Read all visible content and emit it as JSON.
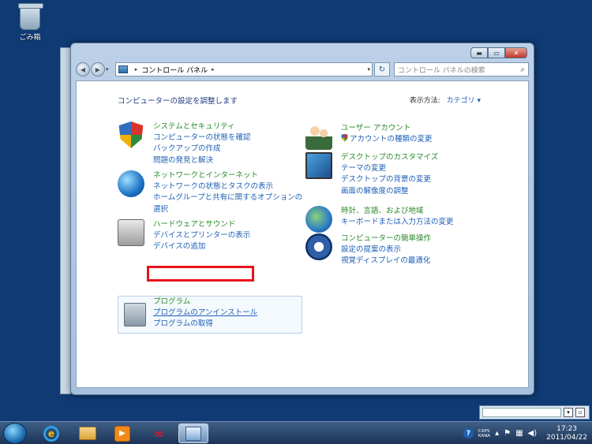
{
  "desktop": {
    "recycle_bin_label": "ごみ箱"
  },
  "window": {
    "address": {
      "path_item": "コントロール パネル",
      "separator": "▸"
    },
    "search": {
      "placeholder": "コントロール パネルの検索"
    },
    "controls": {
      "minimize": "▬",
      "maximize": "▭",
      "close": "✕"
    },
    "page_title": "コンピューターの設定を調整します",
    "view_by": {
      "label": "表示方法:",
      "value": "カテゴリ ▾"
    },
    "left_categories": [
      {
        "icon": "security-shield-icon",
        "heading": "システムとセキュリティ",
        "links": [
          "コンピューターの状態を確認",
          "バックアップの作成",
          "問題の発見と解決"
        ]
      },
      {
        "icon": "network-globe-icon",
        "heading": "ネットワークとインターネット",
        "links": [
          "ネットワークの状態とタスクの表示",
          "ホームグループと共有に関するオプションの",
          "選択"
        ]
      },
      {
        "icon": "printer-icon",
        "heading": "ハードウェアとサウンド",
        "links": [
          "デバイスとプリンターの表示",
          "デバイスの追加"
        ]
      },
      {
        "icon": "programs-disc-icon",
        "heading": "プログラム",
        "links": [
          "プログラムのアンインストール",
          "プログラムの取得"
        ]
      }
    ],
    "right_categories": [
      {
        "icon": "users-icon",
        "heading": "ユーザー アカウント",
        "links": [
          "アカウントの種類の変更"
        ]
      },
      {
        "icon": "desktop-personalize-icon",
        "heading": "デスクトップのカスタマイズ",
        "links": [
          "テーマの変更",
          "デスクトップの背景の変更",
          "画面の解像度の調整"
        ]
      },
      {
        "icon": "clock-globe-icon",
        "heading": "時計、言語、および地域",
        "links": [
          "キーボードまたは入力方法の変更"
        ]
      },
      {
        "icon": "ease-of-access-icon",
        "heading": "コンピューターの簡単操作",
        "links": [
          "設定の提案の表示",
          "視覚ディスプレイの最適化"
        ]
      }
    ]
  },
  "taskbar": {
    "tray": {
      "caps": "CAPS",
      "kana": "KANA"
    },
    "clock": {
      "time": "17:23",
      "date": "2011/04/22"
    }
  }
}
